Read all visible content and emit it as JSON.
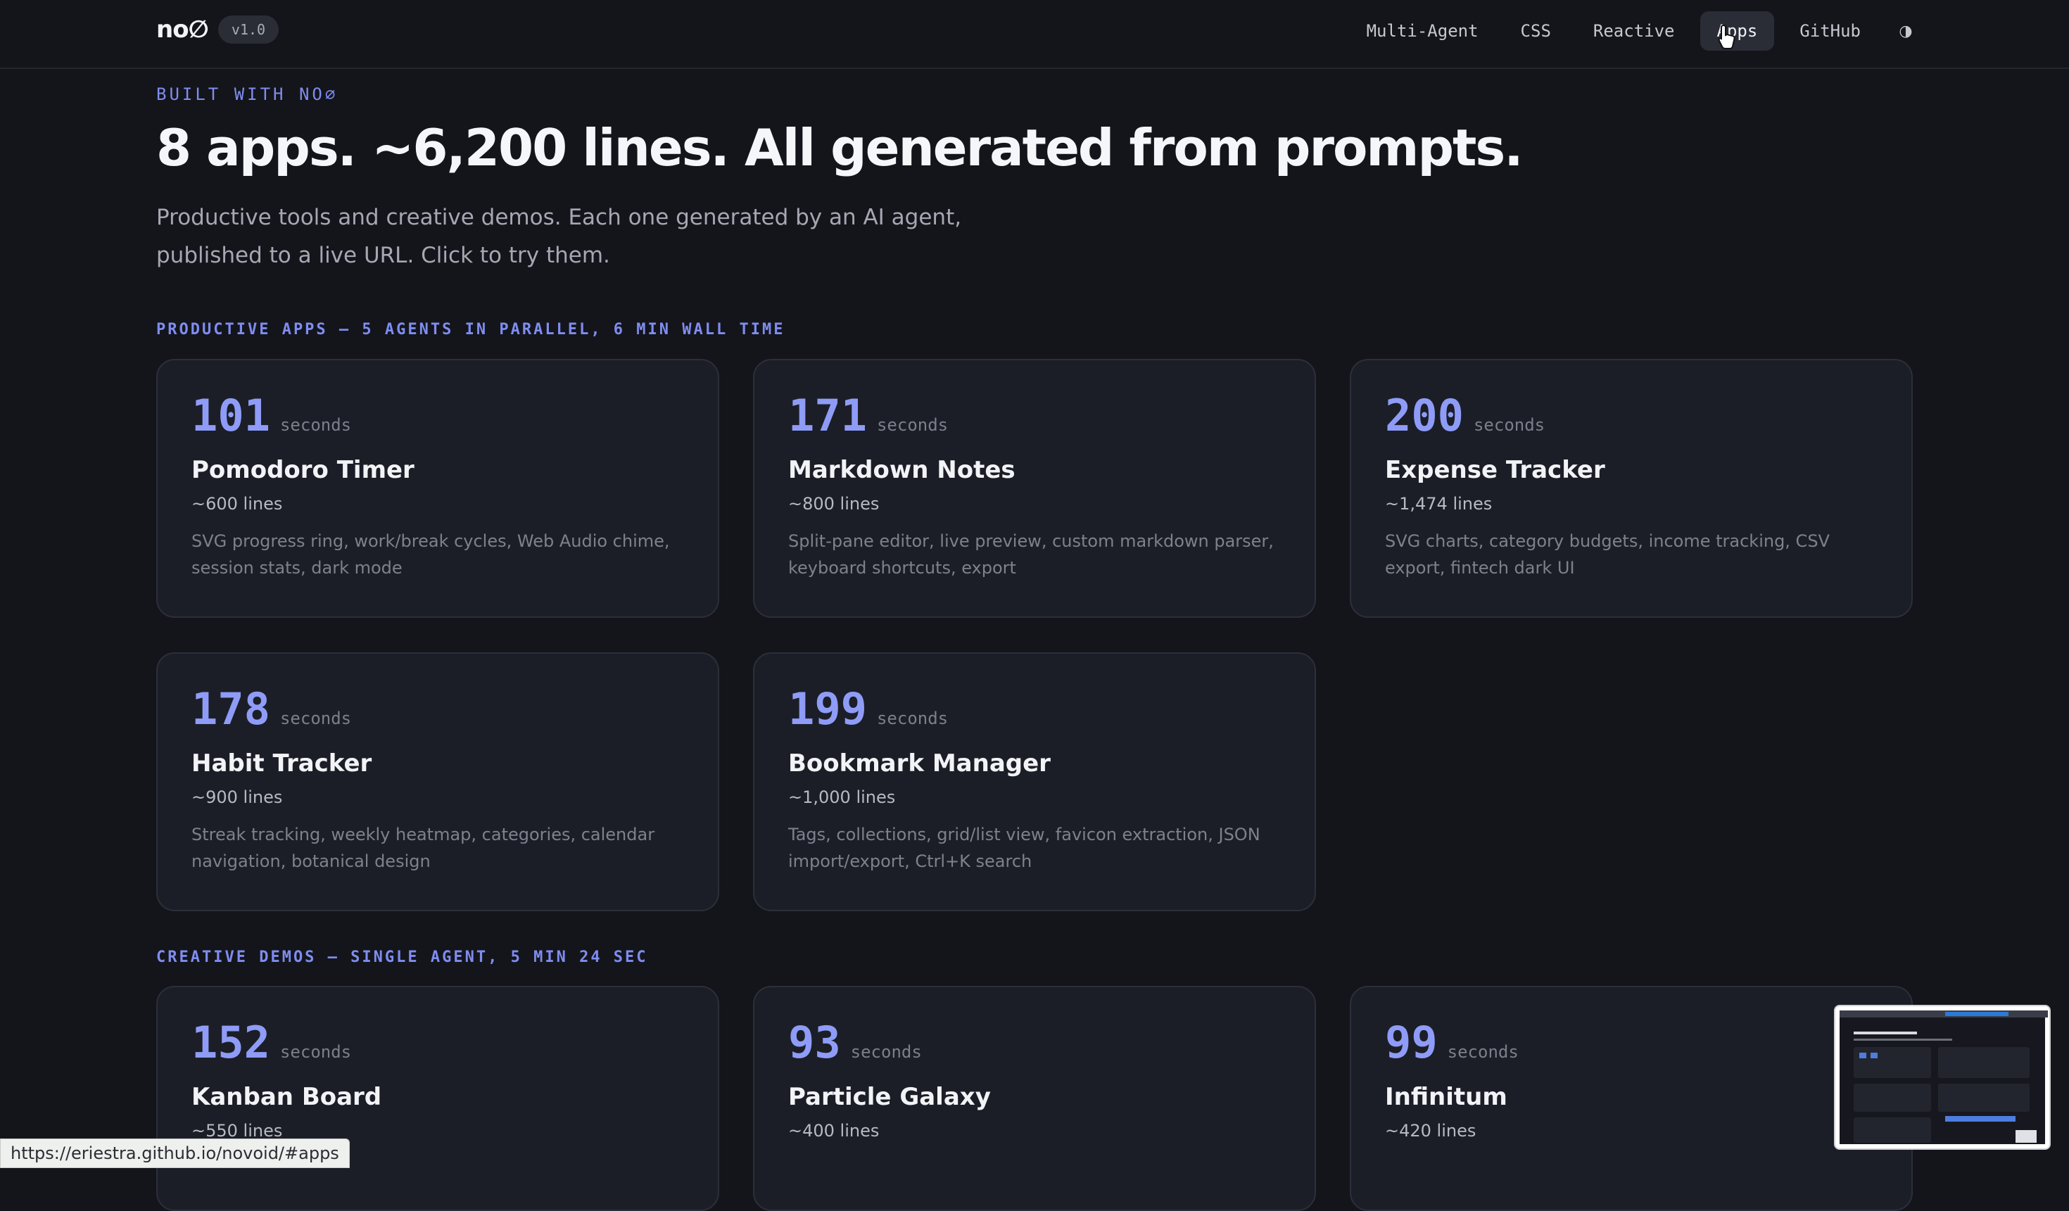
{
  "nav": {
    "logo": "no∅",
    "version": "v1.0",
    "links": [
      {
        "label": "Multi-Agent"
      },
      {
        "label": "CSS"
      },
      {
        "label": "Reactive"
      },
      {
        "label": "Apps",
        "active": true
      },
      {
        "label": "GitHub"
      }
    ],
    "theme_icon": "◑"
  },
  "hero": {
    "eyebrow": "BUILT WITH NO∅",
    "headline": "8 apps. ~6,200 lines. All generated from prompts.",
    "lead": "Productive tools and creative demos. Each one generated by an AI agent, published to a live URL. Click to try them."
  },
  "productive": {
    "label": "PRODUCTIVE APPS — 5 AGENTS IN PARALLEL, 6 MIN WALL TIME",
    "cards": [
      {
        "num": "101",
        "unit": "seconds",
        "name": "Pomodoro Timer",
        "lines": "~600 lines",
        "desc": "SVG progress ring, work/break cycles, Web Audio chime, session stats, dark mode"
      },
      {
        "num": "171",
        "unit": "seconds",
        "name": "Markdown Notes",
        "lines": "~800 lines",
        "desc": "Split-pane editor, live preview, custom markdown parser, keyboard shortcuts, export"
      },
      {
        "num": "200",
        "unit": "seconds",
        "name": "Expense Tracker",
        "lines": "~1,474 lines",
        "desc": "SVG charts, category budgets, income tracking, CSV export, fintech dark UI"
      },
      {
        "num": "178",
        "unit": "seconds",
        "name": "Habit Tracker",
        "lines": "~900 lines",
        "desc": "Streak tracking, weekly heatmap, categories, calendar navigation, botanical design"
      },
      {
        "num": "199",
        "unit": "seconds",
        "name": "Bookmark Manager",
        "lines": "~1,000 lines",
        "desc": "Tags, collections, grid/list view, favicon extraction, JSON import/export, Ctrl+K search"
      }
    ]
  },
  "creative": {
    "label": "CREATIVE DEMOS — SINGLE AGENT, 5 MIN 24 SEC",
    "cards": [
      {
        "num": "152",
        "unit": "seconds",
        "name": "Kanban Board",
        "lines": "~550 lines",
        "desc": ""
      },
      {
        "num": "93",
        "unit": "seconds",
        "name": "Particle Galaxy",
        "lines": "~400 lines",
        "desc": ""
      },
      {
        "num": "99",
        "unit": "seconds",
        "name": "Infinitum",
        "lines": "~420 lines",
        "desc": ""
      }
    ]
  },
  "status_url": "https://eriestra.github.io/novoid/#apps"
}
